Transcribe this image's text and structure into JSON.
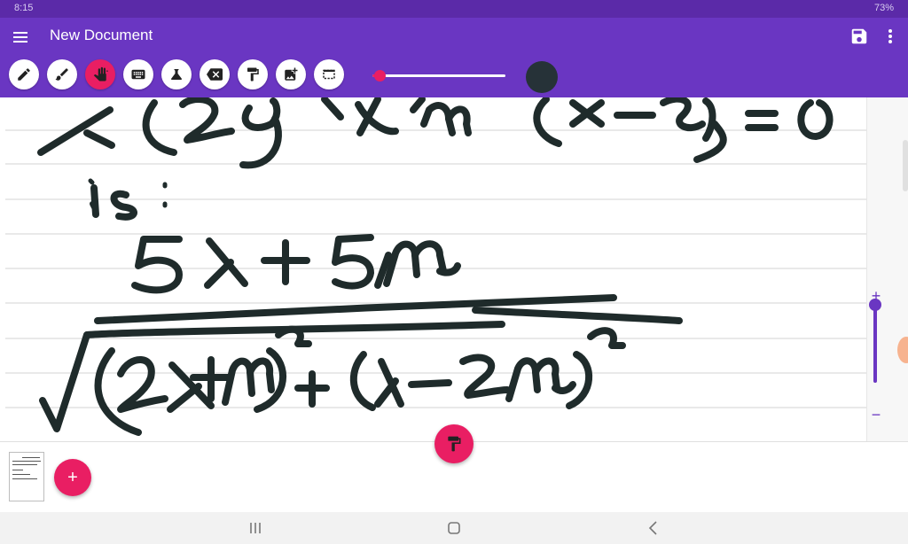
{
  "status_bar": {
    "time": "8:15",
    "battery": "73%"
  },
  "app_bar": {
    "title": "New Document",
    "background": "#6a36c2",
    "accent": "#e91e63"
  },
  "icons": {
    "menu": "menu-icon",
    "save": "save-icon",
    "more": "more-vert-icon"
  },
  "toolbar": {
    "tools": [
      {
        "name": "pen-icon",
        "active": false
      },
      {
        "name": "brush-icon",
        "active": false
      },
      {
        "name": "hand-icon",
        "active": true
      },
      {
        "name": "keyboard-icon",
        "active": false
      },
      {
        "name": "flask-icon",
        "active": false
      },
      {
        "name": "backspace-icon",
        "active": false
      },
      {
        "name": "paint-roller-icon",
        "active": false
      },
      {
        "name": "add-image-icon",
        "active": false
      },
      {
        "name": "selection-icon",
        "active": false
      }
    ],
    "stroke_size_fraction": 0.05,
    "current_color": "#263238"
  },
  "zoom": {
    "level_fraction": 0.5,
    "plus_label": "+",
    "minus_label": "−"
  },
  "pages": {
    "add_label": "+"
  },
  "nav": {
    "recents": "recents-icon",
    "home": "home-icon",
    "back": "back-icon"
  }
}
